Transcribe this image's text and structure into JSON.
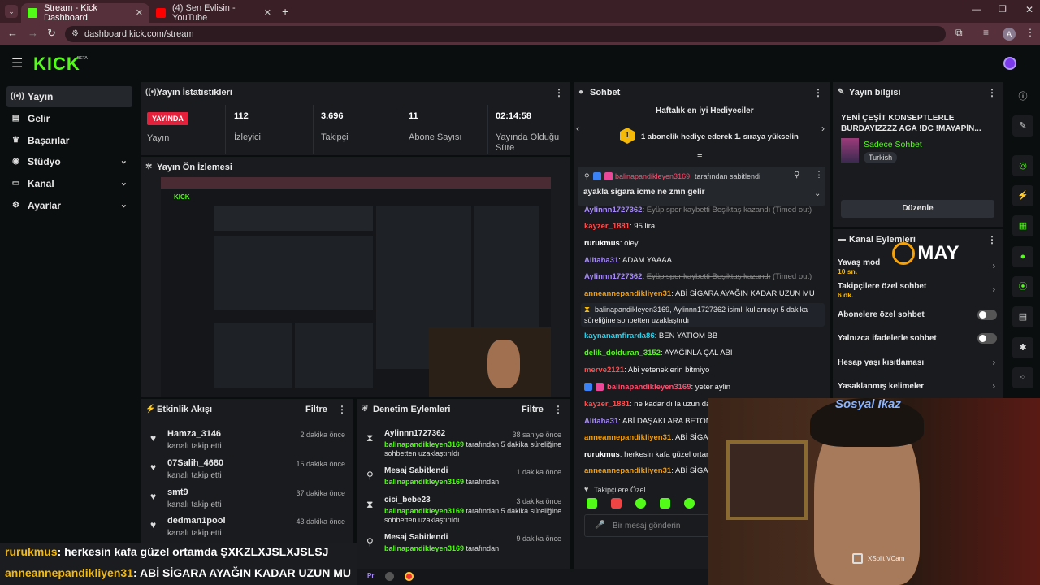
{
  "browser": {
    "tabs": [
      {
        "title": "Stream - Kick Dashboard",
        "active": true
      },
      {
        "title": "(4) Sen Evlisin - YouTube",
        "active": false
      }
    ],
    "url": "dashboard.kick.com/stream",
    "profile_initial": "A"
  },
  "brand": {
    "logo": "KICK",
    "badge": "BETA",
    "accent": "#53fc18"
  },
  "sidebar": {
    "items": [
      {
        "label": "Yayın",
        "icon": "broadcast-icon",
        "active": true
      },
      {
        "label": "Gelir",
        "icon": "wallet-icon"
      },
      {
        "label": "Başarılar",
        "icon": "trophy-icon"
      },
      {
        "label": "Stüdyo",
        "icon": "studio-icon",
        "expandable": true
      },
      {
        "label": "Kanal",
        "icon": "channel-icon",
        "expandable": true
      },
      {
        "label": "Ayarlar",
        "icon": "gear-icon",
        "expandable": true
      }
    ]
  },
  "stats": {
    "title": "Yayın İstatistikleri",
    "live_badge": "YAYINDA",
    "status_label": "Yayın",
    "items": [
      {
        "value": "112",
        "label": "İzleyici"
      },
      {
        "value": "3.696",
        "label": "Takipçi"
      },
      {
        "value": "11",
        "label": "Abone Sayısı"
      },
      {
        "value": "02:14:58",
        "label": "Yayında Olduğu Süre"
      }
    ]
  },
  "preview": {
    "title": "Yayın Ön İzlemesi"
  },
  "activity": {
    "title": "Etkinlik Akışı",
    "filter": "Filtre",
    "items": [
      {
        "name": "Hamza_3146",
        "sub": "kanalı takip etti",
        "time": "2 dakika önce"
      },
      {
        "name": "07Salih_4680",
        "sub": "kanalı takip etti",
        "time": "15 dakika önce"
      },
      {
        "name": "smt9",
        "sub": "kanalı takip etti",
        "time": "37 dakika önce"
      },
      {
        "name": "dedman1pool",
        "sub": "kanalı takip etti",
        "time": "43 dakika önce"
      }
    ]
  },
  "moderation": {
    "title": "Denetim Eylemleri",
    "filter": "Filtre",
    "items": [
      {
        "icon": "hourglass-icon",
        "name": "Aylinnn1727362",
        "by": "balinapandikleyen3169",
        "rest": " tarafından 5 dakika süreliğine sohbetten uzaklaştırıldı",
        "time": "38 saniye önce"
      },
      {
        "icon": "pin-icon",
        "name": "Mesaj Sabitlendi",
        "by": "balinapandikleyen3169",
        "rest": " tarafından",
        "time": "1 dakika önce"
      },
      {
        "icon": "hourglass-icon",
        "name": "cici_bebe23",
        "by": "balinapandikleyen3169",
        "rest": " tarafından 5 dakika süreliğine sohbetten uzaklaştırıldı",
        "time": "3 dakika önce"
      },
      {
        "icon": "pin-icon",
        "name": "Mesaj Sabitlendi",
        "by": "balinapandikleyen3169",
        "rest": " tarafından",
        "time": "9 dakika önce"
      }
    ]
  },
  "chat": {
    "title": "Sohbet",
    "gifters_title": "Haftalık en iyi Hediyeciler",
    "gifters_rank": "1",
    "gifters_cta": "1 abonelik hediye ederek 1. sıraya yükselin",
    "pinned_user": "balinapandikleyen3169",
    "pinned_by": "tarafından sabitlendi",
    "pinned_msg": "ayakla sigara icme ne zmn gelir",
    "messages": [
      {
        "user": "Aylinnn1727362",
        "color": "#a78bfa",
        "text": "Eyüp spor kaybetti Beşiktaş kazandı",
        "deleted": true,
        "note": "(Timed out)"
      },
      {
        "user": "kayzer_1881",
        "color": "#ff4d4d",
        "text": "95 lira"
      },
      {
        "user": "rurukmus",
        "color": "#ffffff",
        "text": "oley"
      },
      {
        "user": "Alitaha31",
        "color": "#a78bfa",
        "text": "ADAM YAAAA"
      },
      {
        "user": "Aylinnn1727362",
        "color": "#a78bfa",
        "text": "Eyüp spor kaybetti Beşiktaş kazandı",
        "deleted": true,
        "note": "(Timed out)"
      },
      {
        "user": "anneannepandikliyen31",
        "color": "#f59e0b",
        "text": "ABİ SİGARA AYAĞIN KADAR UZUN MU"
      }
    ],
    "system_msg_line1": "balinapandikleyen3169, Aylinnn1727362 isimli kullanıcıyı 5 dakika",
    "system_msg_line2": "süreliğine sohbetten uzaklaştırdı",
    "messages2": [
      {
        "user": "kaynanamfirarda86",
        "color": "#22d3ee",
        "text": "BEN YATIOM BB"
      },
      {
        "user": "delik_dolduran_3152",
        "color": "#53fc18",
        "text": "AYAĞINLA ÇAL ABİ"
      },
      {
        "user": "merve2121",
        "color": "#ff4d4d",
        "text": "Abi yeteneklerin bitmiyo"
      },
      {
        "user": "balinapandikleyen3169",
        "color": "#ff4d6d",
        "text": "yeter aylin"
      },
      {
        "user": "kayzer_1881",
        "color": "#ff4d4d",
        "text": "ne kadar dı la uzun dark"
      },
      {
        "user": "Alitaha31",
        "color": "#a78bfa",
        "text": "ABİ DAŞAKLARA BETON Y"
      },
      {
        "user": "anneannepandikliyen31",
        "color": "#f59e0b",
        "text": "ABİ SİGARA"
      },
      {
        "user": "rurukmus",
        "color": "#ffffff",
        "text": "herkesin kafa güzel ortam"
      },
      {
        "user": "anneannepandikliyen31",
        "color": "#f59e0b",
        "text": "ABİ SİGARA"
      }
    ],
    "followers_only": "Takipçilere Özel",
    "input_placeholder": "Bir mesaj gönderin"
  },
  "stream_info": {
    "title": "Yayın bilgisi",
    "stream_title": "YENİ ÇEŞİT KONSEPTLERLE BURDAYIZZZZ AGA !DC !MAYAPİN...",
    "category": "Sadece Sohbet",
    "language": "Turkish",
    "edit_button": "Düzenle"
  },
  "channel_actions": {
    "title": "Kanal Eylemleri",
    "slow_mode": "Yavaş mod",
    "slow_mode_value": "10 sn.",
    "followers_chat": "Takipçilere özel sohbet",
    "followers_chat_value": "6 dk.",
    "subs_chat": "Abonelere özel sohbet",
    "emote_chat": "Yalnızca ifadelerle sohbet",
    "account_age": "Hesap yaşı kısıtlaması",
    "banned_words": "Yasaklanmış kelimeler"
  },
  "overlay": {
    "brand": "MAY",
    "webcam_title": "Sosyal Ikaz",
    "vcam": "XSplit VCam",
    "ticker": [
      {
        "user": "rurukmus",
        "text": ": herkesin kafa güzel ortamda ŞXKZLXJSLXJSLSJ"
      },
      {
        "user": "anneannepandikliyen31",
        "text": ": ABİ SİGARA AYAĞIN KADAR UZUN MU"
      }
    ]
  }
}
